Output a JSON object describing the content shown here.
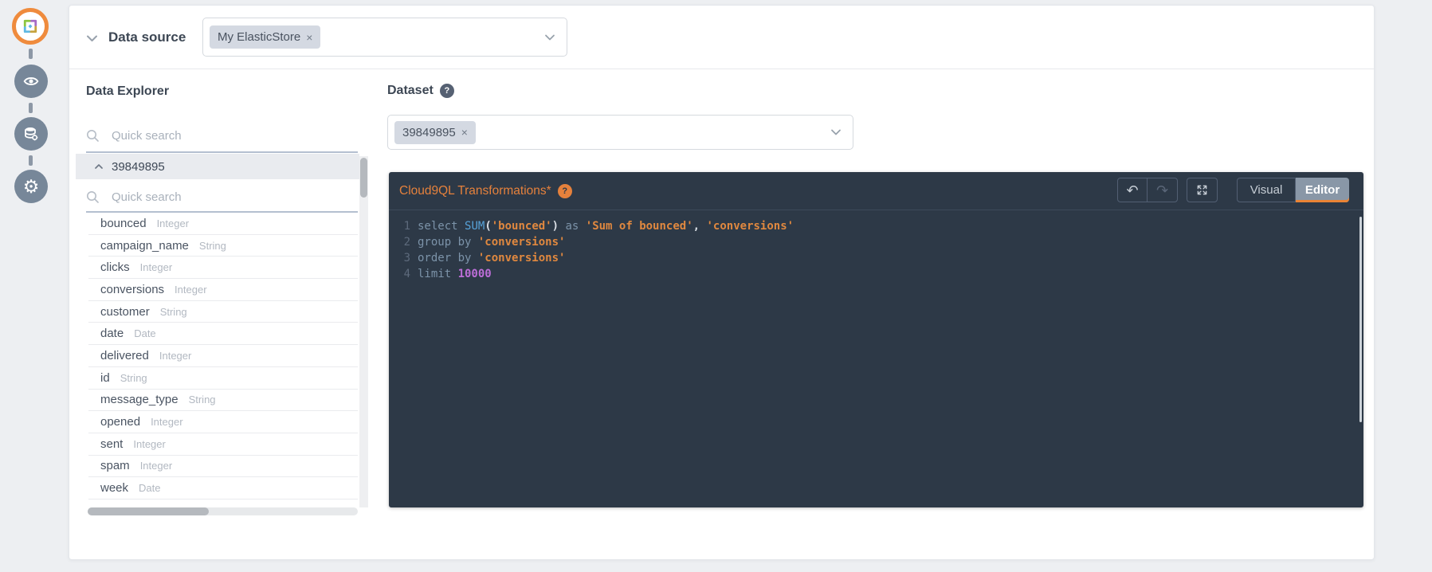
{
  "sidebar": {
    "icons": [
      {
        "name": "app-logo",
        "shape": "svg-star"
      },
      {
        "name": "eye-icon",
        "shape": "svg-eye"
      },
      {
        "name": "database-gear-icon",
        "shape": "svg-database"
      },
      {
        "name": "settings-gear-icon",
        "glyph": "⚙"
      }
    ]
  },
  "header": {
    "collapse_label": "Data source",
    "source_tag": "My ElasticStore",
    "remove_symbol": "×"
  },
  "explorer": {
    "title": "Data Explorer",
    "quick_search_placeholder": "Quick search",
    "group_label": "39849895",
    "field_search_placeholder": "Quick search",
    "fields": [
      {
        "name": "bounced",
        "type": "Integer"
      },
      {
        "name": "campaign_name",
        "type": "String"
      },
      {
        "name": "clicks",
        "type": "Integer"
      },
      {
        "name": "conversions",
        "type": "Integer"
      },
      {
        "name": "customer",
        "type": "String"
      },
      {
        "name": "date",
        "type": "Date"
      },
      {
        "name": "delivered",
        "type": "Integer"
      },
      {
        "name": "id",
        "type": "String"
      },
      {
        "name": "message_type",
        "type": "String"
      },
      {
        "name": "opened",
        "type": "Integer"
      },
      {
        "name": "sent",
        "type": "Integer"
      },
      {
        "name": "spam",
        "type": "Integer"
      },
      {
        "name": "week",
        "type": "Date"
      }
    ]
  },
  "dataset": {
    "label": "Dataset",
    "help_symbol": "?",
    "tag_label": "39849895",
    "remove_symbol": "×"
  },
  "cloud9ql": {
    "title": "Cloud9QL Transformations*",
    "help_symbol": "?",
    "visual_tab": "Visual",
    "editor_tab": "Editor",
    "code_lines": [
      {
        "num": "1",
        "tokens": [
          [
            "kw",
            "select "
          ],
          [
            "fn",
            "SUM"
          ],
          [
            "punct",
            "("
          ],
          [
            "str",
            "'bounced'"
          ],
          [
            "punct",
            ")"
          ],
          [
            "kw",
            " as "
          ],
          [
            "str",
            "'Sum of bounced'"
          ],
          [
            "punct",
            ","
          ],
          [
            "plain",
            " "
          ],
          [
            "str",
            "'conversions'"
          ]
        ]
      },
      {
        "num": "2",
        "tokens": [
          [
            "kw",
            "group by "
          ],
          [
            "str",
            "'conversions'"
          ]
        ]
      },
      {
        "num": "3",
        "tokens": [
          [
            "kw",
            "order by "
          ],
          [
            "str",
            "'conversions'"
          ]
        ]
      },
      {
        "num": "4",
        "tokens": [
          [
            "kw",
            "limit "
          ],
          [
            "num",
            "10000"
          ]
        ]
      }
    ]
  },
  "icons": {
    "undo": "↶",
    "redo": "↷",
    "settings_gear": "⚙"
  },
  "colors": {
    "accent_orange": "#ea8435",
    "editor_title_orange": "#e5813c",
    "editor_bg": "#2d3947",
    "sidebar_icon_bg": "#778799",
    "logo_ring": "#ef8b3d",
    "tag_bg": "#d4d9e2",
    "highlight_row_bg": "#e9ebef",
    "strong_divider": "#b4bfd0",
    "code_keyword": "#7c93a9",
    "code_function": "#57a2d8",
    "code_string": "#e0883f",
    "code_number": "#bd6ed8"
  }
}
